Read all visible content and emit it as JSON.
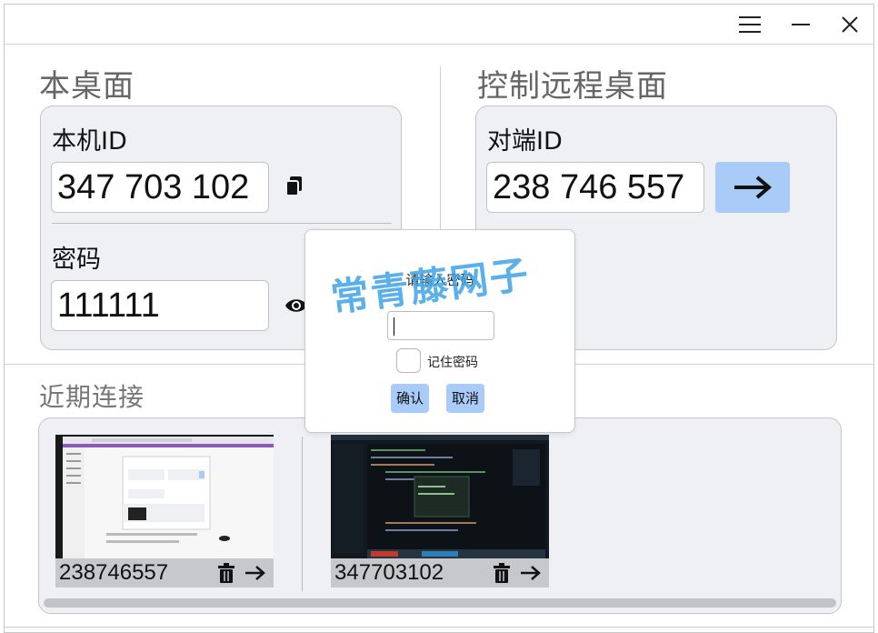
{
  "local": {
    "section_title": "本桌面",
    "id_label": "本机ID",
    "id_value": "347 703 102",
    "password_label": "密码",
    "password_value": "111111"
  },
  "remote": {
    "section_title": "控制远程桌面",
    "id_label": "对端ID",
    "id_value": "238 746 557"
  },
  "recent": {
    "section_title": "近期连接",
    "items": [
      {
        "id": "238746557"
      },
      {
        "id": "347703102"
      }
    ]
  },
  "dialog": {
    "title": "请输入密码",
    "input_value": "",
    "remember_label": "记住密码",
    "confirm_label": "确认",
    "cancel_label": "取消"
  },
  "watermark": "常青藤网子",
  "colors": {
    "accent": "#a9cbf7",
    "card_bg": "#eef0f4",
    "watermark": "#3fa3e6"
  }
}
